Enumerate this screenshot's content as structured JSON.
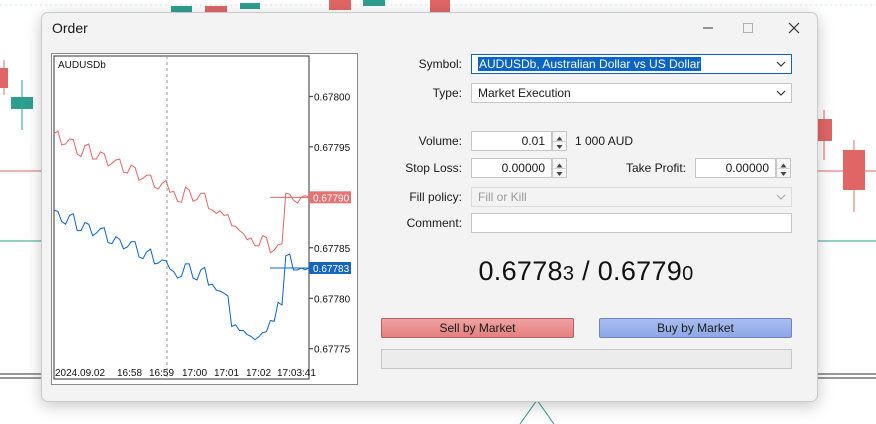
{
  "window": {
    "title": "Order"
  },
  "mini_chart": {
    "symbol_label": "AUDUSDb",
    "price_ticks": [
      "0.67800",
      "0.67795",
      "0.67785",
      "0.67780",
      "0.67775"
    ],
    "time_ticks": [
      "2024.09.02",
      "16:58",
      "16:59",
      "17:00",
      "17:01",
      "17:02",
      "17:03:41"
    ],
    "ask_tag": "0.67790",
    "bid_tag": "0.67783",
    "colors": {
      "ask": "#e06666",
      "bid": "#0a64c8",
      "ask_tag_bg": "#e57373",
      "bid_tag_bg": "#1565c0"
    }
  },
  "chart_data": {
    "type": "line",
    "title": "",
    "xlabel": "",
    "ylabel": "",
    "ylim": [
      0.67772,
      0.67804
    ],
    "series": [
      {
        "name": "",
        "values": [
          0.677963,
          0.677952,
          0.677958,
          0.677943,
          0.677951,
          0.677938,
          0.677945,
          0.677931,
          0.677937,
          0.677925,
          0.677932,
          0.677917,
          0.677922,
          0.67791,
          0.677914,
          0.677905,
          0.677896,
          0.67791,
          0.677896,
          0.677904,
          0.677889,
          0.677884,
          0.677882,
          0.677872,
          0.677867,
          0.677858,
          0.677852,
          0.677862,
          0.677845,
          0.677853,
          0.677904,
          0.677897,
          0.6779,
          0.6779
        ]
      },
      {
        "name": "",
        "values": [
          0.677887,
          0.677876,
          0.677882,
          0.677867,
          0.677875,
          0.677862,
          0.677869,
          0.677855,
          0.677861,
          0.677849,
          0.677856,
          0.677841,
          0.677846,
          0.677834,
          0.677838,
          0.677829,
          0.67782,
          0.677834,
          0.67782,
          0.677828,
          0.677813,
          0.677808,
          0.677805,
          0.677772,
          0.677768,
          0.677764,
          0.677759,
          0.677766,
          0.677778,
          0.677796,
          0.677842,
          0.677828,
          0.67783,
          0.67783
        ]
      }
    ]
  },
  "form": {
    "symbol": {
      "label": "Symbol:",
      "value": "AUDUSDb, Australian Dollar vs US Dollar"
    },
    "type": {
      "label": "Type:",
      "value": "Market Execution"
    },
    "volume": {
      "label": "Volume:",
      "value": "0.01",
      "unit": "1 000 AUD"
    },
    "stop_loss": {
      "label": "Stop Loss:",
      "value": "0.00000"
    },
    "take_profit": {
      "label": "Take Profit:",
      "value": "0.00000"
    },
    "fill_policy": {
      "label": "Fill policy:",
      "value": "Fill or Kill"
    },
    "comment": {
      "label": "Comment:",
      "value": ""
    }
  },
  "quote": {
    "bid_main": "0.6778",
    "bid_small": "3",
    "separator": "/",
    "ask_main": "0.6779",
    "ask_small": "0"
  },
  "buttons": {
    "sell": "Sell by Market",
    "buy": "Buy by Market"
  },
  "progress": {
    "value": 0
  },
  "icons": {
    "minimize": "minimize-icon",
    "maximize": "maximize-icon",
    "close": "close-icon"
  }
}
